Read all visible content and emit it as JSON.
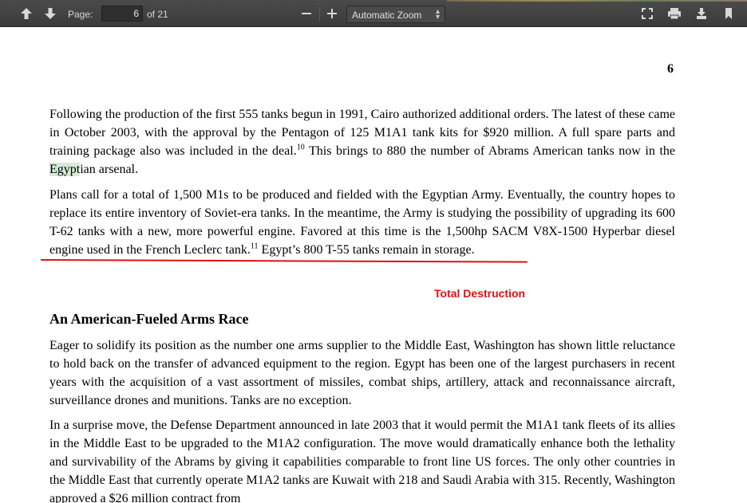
{
  "toolbar": {
    "page_label": "Page:",
    "page_value": "6",
    "page_total": "of 21",
    "zoom_minus": "—",
    "zoom_plus": "+",
    "zoom_value": "Automatic Zoom",
    "icons": [
      "arrow-up-icon",
      "arrow-down-icon",
      "zoom-out-icon",
      "zoom-in-icon",
      "fullscreen-icon",
      "print-icon",
      "download-icon",
      "bookmark-icon"
    ]
  },
  "document": {
    "page_number": "6",
    "p1": {
      "a": "Following the production of the first 555 tanks begun in 1991, Cairo authorized additional orders. The latest of these came in October 2003, with the approval by the Pentagon of 125 M1A1 tank kits for $920 million. A full spare parts and training package also was included in the deal.",
      "fn1": "10",
      "b": " This brings to 880 the number of Abrams American tanks now in the ",
      "highlight": "Egypt",
      "c": "ian arsenal."
    },
    "p2": {
      "a": "Plans call for a total of 1,500 M1s to be produced and fielded with the Egyptian Army. Eventually, the country hopes to replace its entire inventory of Soviet-era tanks. In the meantime, the Army is studying the possibility of upgrading its 600 T-62 tanks with a new, more powerful engine. Favored at this time is the 1,500hp SACM V8X-1500 Hyperbar diesel engine used in the French Leclerc tank.",
      "fn": "11",
      "b": " Egypt’s 800 T-55 tanks remain in storage."
    },
    "annotation": "Total Destruction",
    "heading": "An American-Fueled Arms Race",
    "p3": "Eager to solidify its position as the number one arms supplier to the Middle East, Washington has shown little reluctance to hold back on the transfer of advanced equipment to the region. Egypt has been one of the largest purchasers in recent years with the acquisition of a vast assortment of missiles, combat ships, artillery, attack and reconnaissance aircraft, surveillance drones and munitions. Tanks are no exception.",
    "p4": "In a surprise move, the Defense Department announced in late 2003 that it would permit the M1A1 tank fleets of its allies in the Middle East to be upgraded to the M1A2 configuration. The move would dramatically enhance both the lethality and survivability of the Abrams by giving it capabilities comparable to front line US forces. The only other countries in the Middle East that currently operate M1A2 tanks are Kuwait with 218 and Saudi Arabia with 315. Recently, Washington approved a $26 million contract from"
  }
}
